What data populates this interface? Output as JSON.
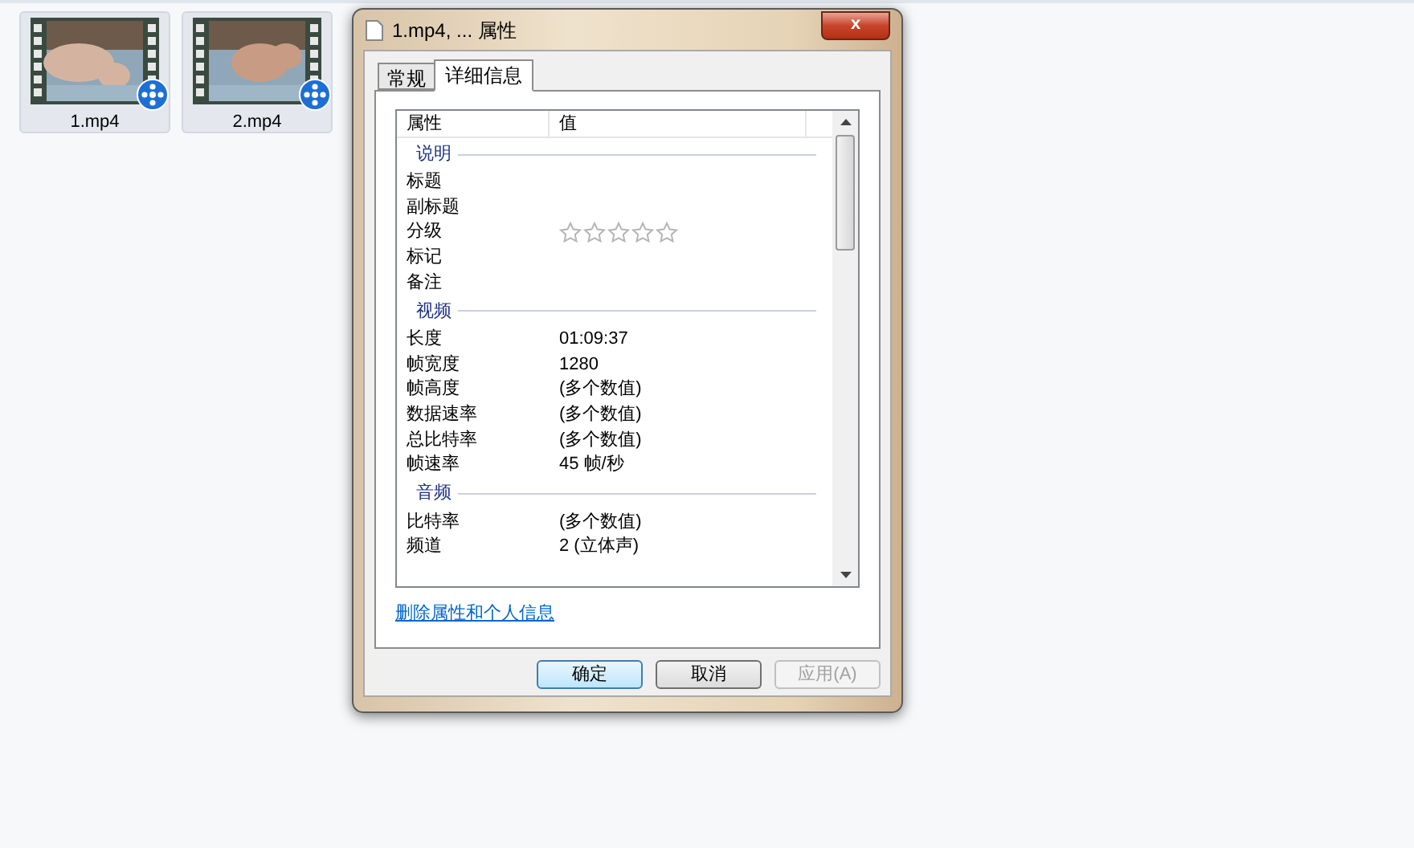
{
  "desktop_files": [
    {
      "name": "1.mp4",
      "selected": true
    },
    {
      "name": "2.mp4",
      "selected": true
    }
  ],
  "window": {
    "title": "1.mp4, ... 属性",
    "close": "x"
  },
  "tabs": [
    {
      "label": "常规",
      "selected": false
    },
    {
      "label": "详细信息",
      "selected": true
    }
  ],
  "columns": [
    "属性",
    "值"
  ],
  "sections": [
    {
      "title": "说明",
      "rows": [
        {
          "kind": "text",
          "name": "标题"
        },
        {
          "kind": "text",
          "name": "副标题"
        },
        {
          "kind": "stars",
          "name": "分级",
          "stars": 0
        },
        {
          "kind": "text",
          "name": "标记"
        },
        {
          "kind": "text",
          "name": "备注"
        }
      ]
    },
    {
      "title": "视频",
      "rows": [
        {
          "kind": "text",
          "name": "长度",
          "value": "01:09:37"
        },
        {
          "kind": "text",
          "name": "帧宽度",
          "value": "1280"
        },
        {
          "kind": "text",
          "name": "帧高度",
          "value": "(多个数值)"
        },
        {
          "kind": "text",
          "name": "数据速率",
          "value": "(多个数值)"
        },
        {
          "kind": "text",
          "name": "总比特率",
          "value": "(多个数值)"
        },
        {
          "kind": "text",
          "name": "帧速率",
          "value": "45 帧/秒"
        }
      ]
    },
    {
      "title": "音频",
      "rows": [
        {
          "kind": "text",
          "name": "比特率",
          "value": "(多个数值)"
        },
        {
          "kind": "text",
          "name": "频道",
          "value": "2 (立体声)"
        }
      ]
    }
  ],
  "link": "删除属性和个人信息",
  "buttons": [
    {
      "label": "确定",
      "default": true,
      "disabled": false
    },
    {
      "label": "取消",
      "default": false,
      "disabled": false
    },
    {
      "label": "应用(A)",
      "default": false,
      "disabled": true
    }
  ]
}
